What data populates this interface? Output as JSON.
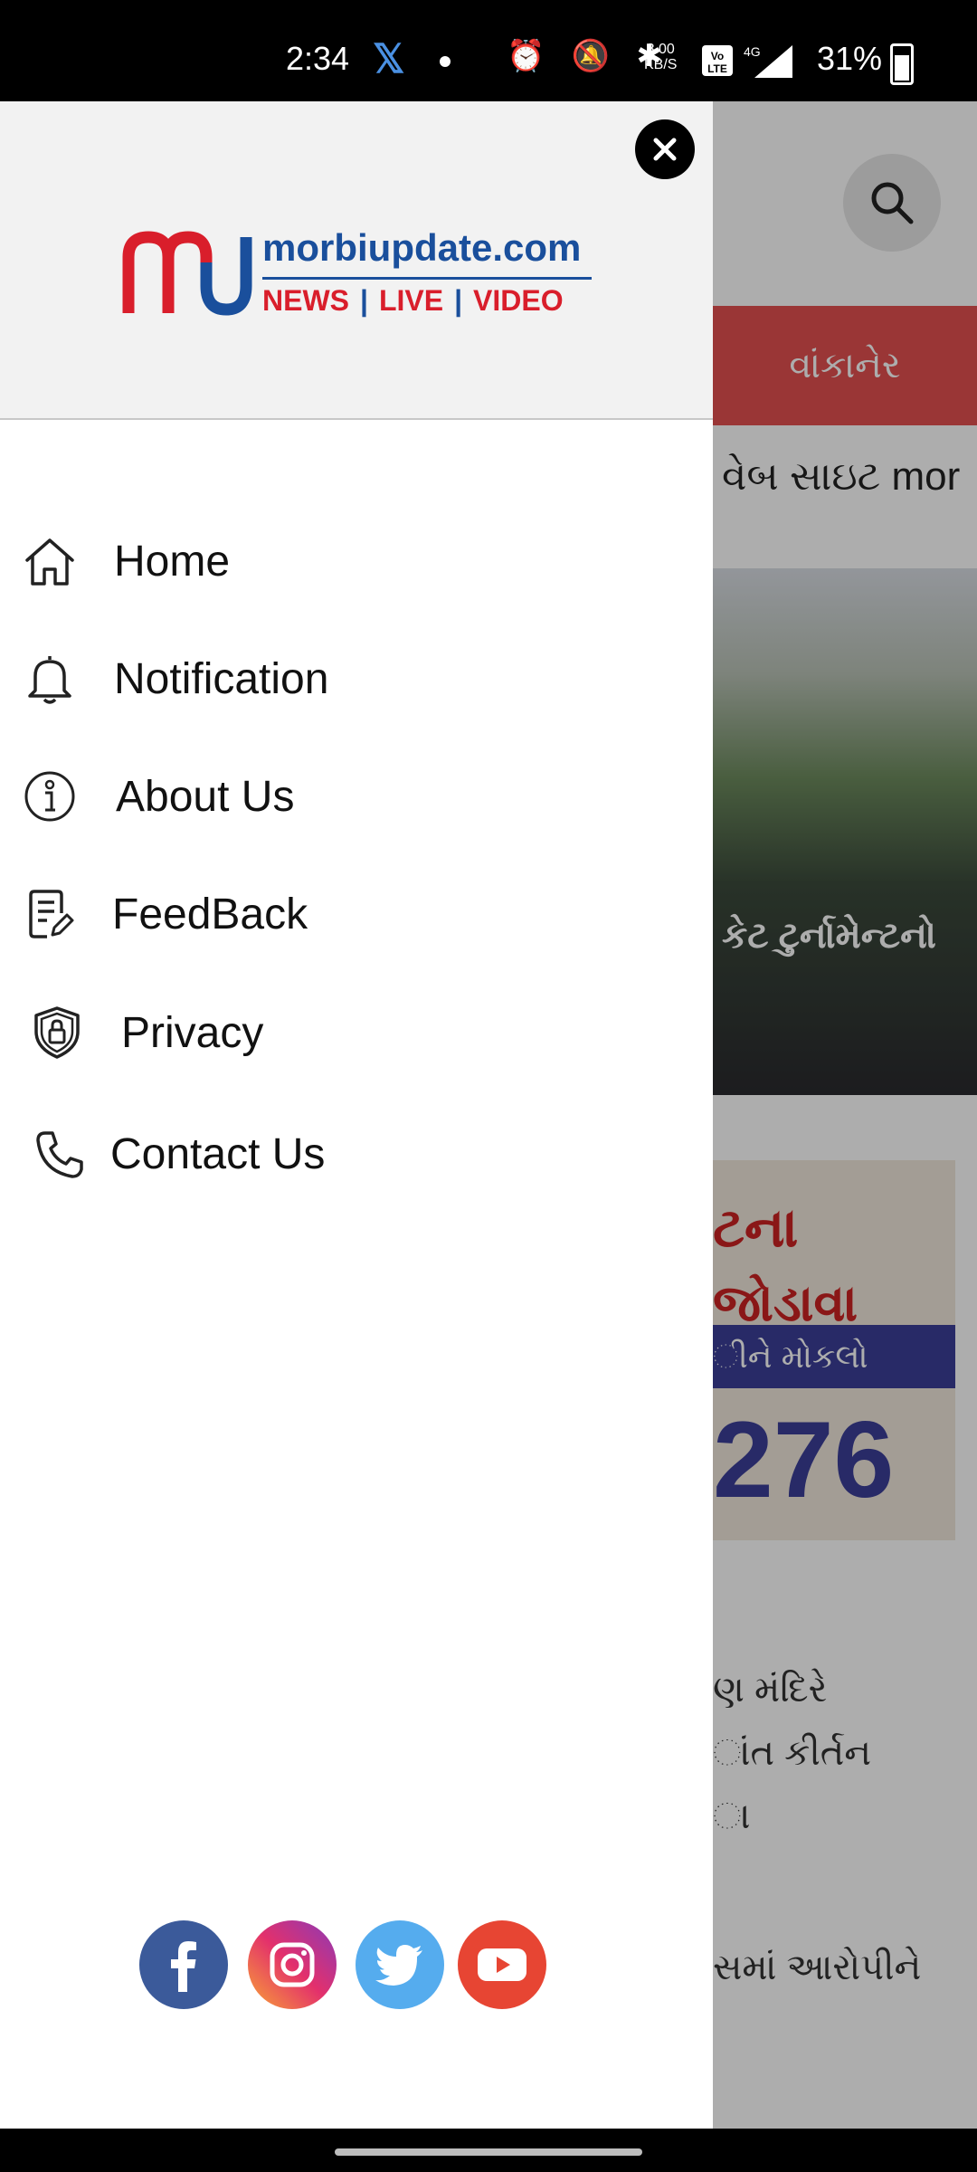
{
  "status_bar": {
    "time": "2:34",
    "net_speed": "8.00\nKB/S",
    "battery": "31%"
  },
  "background_app": {
    "category": "વાંકાનેર",
    "headline": "વેબ સાઇટ mor",
    "photo_caption": "કેટ ટુર્નામેન્ટનો",
    "ad_line1": "ટના",
    "ad_line2": "જોડાવા",
    "ad_band": "ીને મોકલો",
    "ad_number": "276",
    "snippet_lines": [
      "ણ મંદિરે",
      "ાંત કીર્તન",
      "ા"
    ],
    "snippet2": "સમાં આરોપીને"
  },
  "drawer": {
    "logo": {
      "domain": "morbiupdate.com",
      "tag_news": "NEWS",
      "tag_live": "LIVE",
      "tag_video": "VIDEO"
    },
    "menu": [
      {
        "label": "Home",
        "icon": "home-icon"
      },
      {
        "label": "Notification",
        "icon": "bell-icon"
      },
      {
        "label": "About Us",
        "icon": "info-icon"
      },
      {
        "label": "FeedBack",
        "icon": "feedback-icon"
      },
      {
        "label": "Privacy",
        "icon": "shield-lock-icon"
      },
      {
        "label": "Contact Us",
        "icon": "phone-icon"
      }
    ],
    "social": [
      "facebook-icon",
      "instagram-icon",
      "twitter-icon",
      "youtube-icon"
    ]
  },
  "colors": {
    "brand_blue": "#1a4f9c",
    "brand_red": "#d91e2b",
    "category_red": "#e45050"
  }
}
